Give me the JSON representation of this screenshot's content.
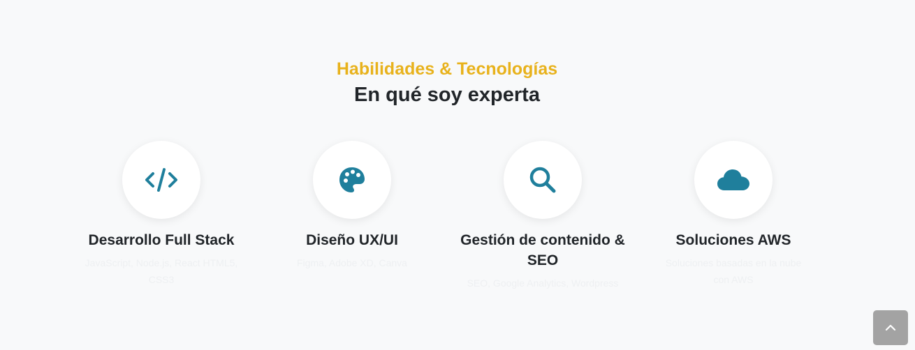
{
  "header": {
    "subtitle": "Habilidades & Tecnologías",
    "title": "En qué soy experta"
  },
  "colors": {
    "accent": "#e8b21c",
    "icon": "#1f7f9c",
    "heading": "#212529"
  },
  "skills": [
    {
      "icon": "code-icon",
      "title": "Desarrollo Full Stack",
      "text": "JavaScript, Node.js, React HTML5, CSS3"
    },
    {
      "icon": "palette-icon",
      "title": "Diseño UX/UI",
      "text": "Figma, Adobe XD, Canva"
    },
    {
      "icon": "search-icon",
      "title": "Gestión de contenido & SEO",
      "text": "SEO, Google Analytics, Wordpress"
    },
    {
      "icon": "cloud-icon",
      "title": "Soluciones AWS",
      "text": "Soluciones basadas en la nube con AWS"
    }
  ],
  "back_to_top": {
    "icon": "chevron-up-icon"
  }
}
